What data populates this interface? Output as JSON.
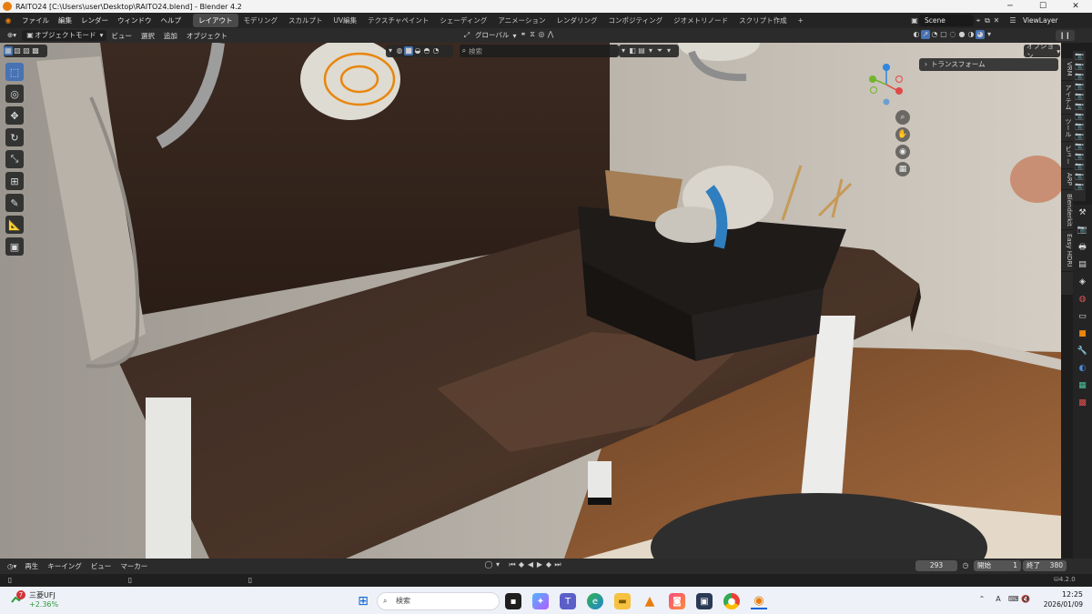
{
  "window": {
    "title": "RAITO24 [C:\\Users\\user\\Desktop\\RAITO24.blend] - Blender 4.2",
    "minimize": "─",
    "maximize": "☐",
    "close": "✕"
  },
  "menu": [
    "ファイル",
    "編集",
    "レンダー",
    "ウィンドウ",
    "ヘルプ"
  ],
  "workspaces": [
    "レイアウト",
    "モデリング",
    "スカルプト",
    "UV編集",
    "テクスチャペイント",
    "シェーディング",
    "アニメーション",
    "レンダリング",
    "コンポジティング",
    "ジオメトリノード",
    "スクリプト作成"
  ],
  "workspace_add": "+",
  "active_workspace": "レイアウト",
  "scene": {
    "name": "Scene",
    "view_layer": "ViewLayer"
  },
  "viewport_header": {
    "mode": "オブジェクトモード",
    "menus": [
      "ビュー",
      "選択",
      "追加",
      "オブジェクト"
    ],
    "transform_orientation": "グローバル",
    "search_placeholder": "検索",
    "options": "オプション"
  },
  "npanel": {
    "section": "トランスフォーム",
    "tabs": [
      "VRM",
      "アイテム",
      "ツール",
      "ビュー",
      "ARP",
      "Blenderkit",
      "Easy HDRI"
    ]
  },
  "timeline": {
    "menus": [
      "再生",
      "キーイング",
      "ビュー",
      "マーカー"
    ],
    "current_frame": "293",
    "start_label": "開始",
    "start": "1",
    "end_label": "終了",
    "end": "380",
    "version": "4.2.0"
  },
  "taskbar": {
    "stock_name": "三菱UFJ",
    "stock_change": "+2.36%",
    "notification_count": "7",
    "search_placeholder": "検索",
    "ime": "A",
    "time": "12:25",
    "date": "2026/01/09"
  },
  "colors": {
    "accent": "#4772b3",
    "active_object_outline": "#e8860d",
    "stock_up": "#2e9b3c"
  }
}
